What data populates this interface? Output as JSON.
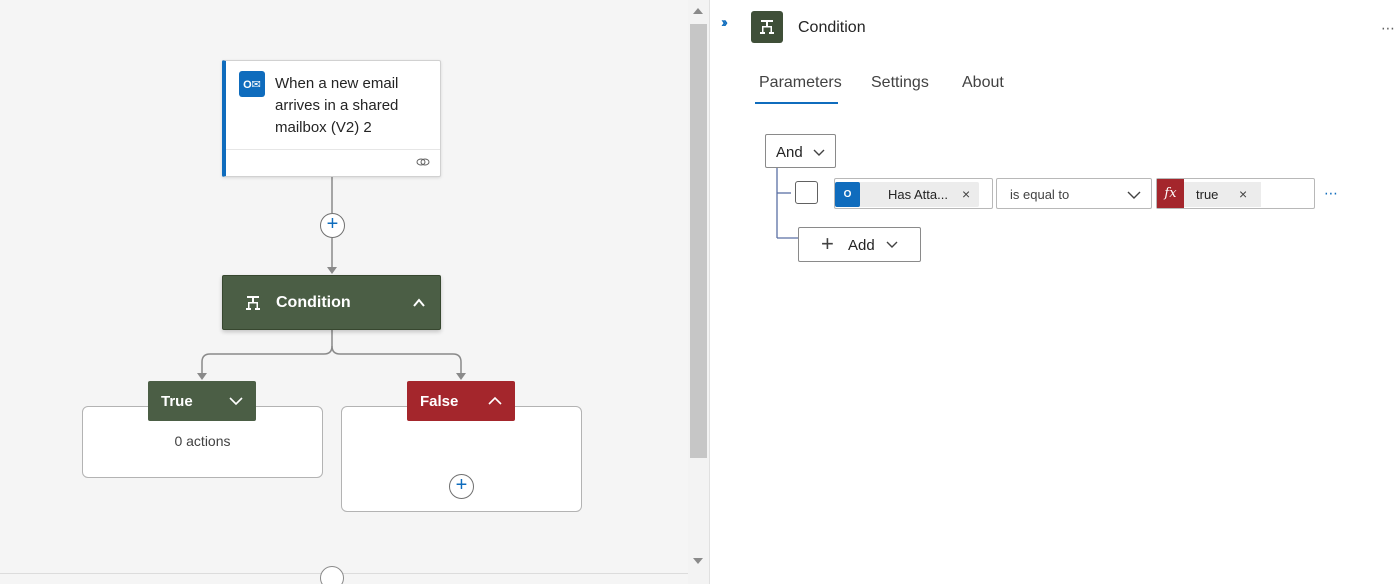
{
  "canvas": {
    "trigger": {
      "title": "When a new email arrives in a shared mailbox (V2) 2",
      "icon": "outlook-icon"
    },
    "condition": {
      "label": "Condition",
      "icon": "condition-icon"
    },
    "true_branch": {
      "label": "True",
      "empty_text": "0 actions"
    },
    "false_branch": {
      "label": "False"
    }
  },
  "panel": {
    "title": "Condition",
    "tabs": [
      "Parameters",
      "Settings",
      "About"
    ],
    "active_tab": "Parameters",
    "group_operator": "And",
    "row": {
      "left_token": "Has Atta...",
      "operator": "is equal to",
      "right_token": "true",
      "right_token_type": "fx"
    },
    "add_label": "Add"
  },
  "colors": {
    "accent": "#0f6cbd",
    "condition_green": "#4b5e45",
    "false_red": "#a4262c"
  }
}
